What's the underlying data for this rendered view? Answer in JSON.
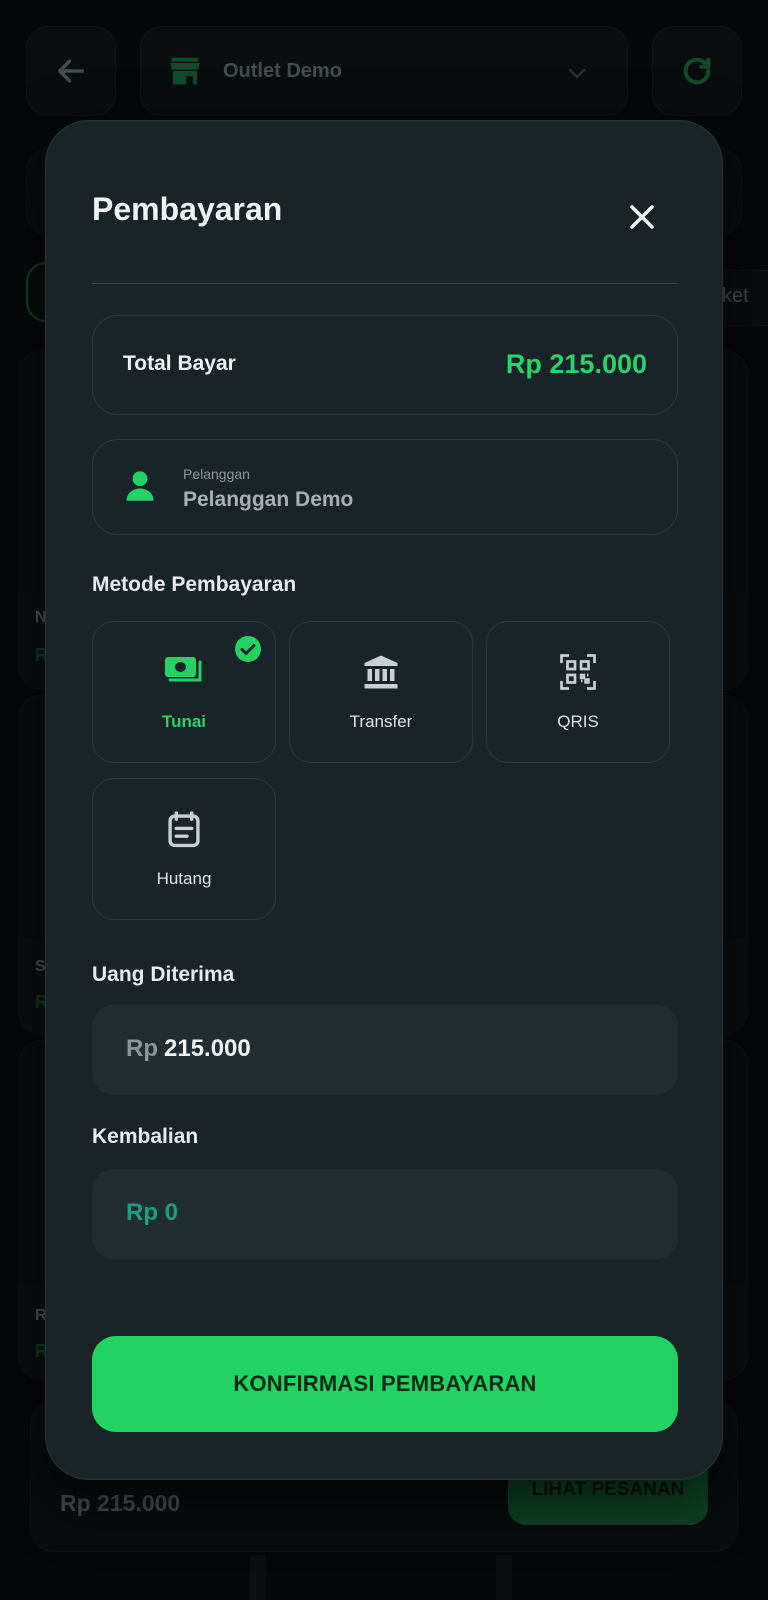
{
  "background": {
    "outlet_name": "Outlet Demo",
    "filter_chip_partial": "ket",
    "product_letters": [
      "N",
      "S",
      "R"
    ],
    "product_price_letters": [
      "R",
      "R",
      "R"
    ],
    "bottom_total": "Rp 215.000",
    "bottom_button": "LIHAT PESANAN"
  },
  "modal": {
    "title": "Pembayaran",
    "total_label": "Total Bayar",
    "total_value": "Rp 215.000",
    "customer_caption": "Pelanggan",
    "customer_name": "Pelanggan Demo",
    "methods_label": "Metode Pembayaran",
    "methods": [
      {
        "label": "Tunai",
        "icon": "cash-icon",
        "selected": true
      },
      {
        "label": "Transfer",
        "icon": "bank-icon",
        "selected": false
      },
      {
        "label": "QRIS",
        "icon": "qr-code-icon",
        "selected": false
      },
      {
        "label": "Hutang",
        "icon": "note-icon",
        "selected": false
      }
    ],
    "received_label": "Uang Diterima",
    "received_prefix": "Rp",
    "received_value": "215.000",
    "change_label": "Kembalian",
    "change_value": "Rp 0",
    "confirm_button": "KONFIRMASI PEMBAYARAN"
  },
  "colors": {
    "accent": "#22d364",
    "accent_text": "#27d46a",
    "modal_bg": "#1a2328",
    "page_bg": "#0c1114",
    "change_text": "#1aa080"
  }
}
